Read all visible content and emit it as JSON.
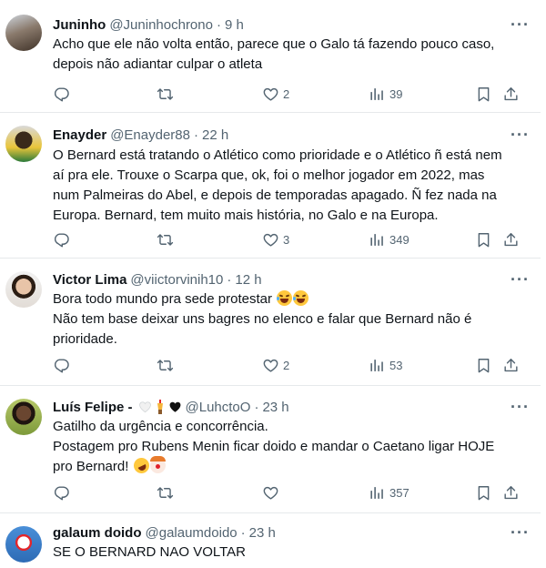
{
  "tweets": [
    {
      "name": "Juninho",
      "handle": "@Juninhochrono",
      "time": "9 h",
      "lines": [
        "Acho que ele não volta então, parece que o Galo tá fazendo pouco caso,",
        "depois não adiantar culpar o atleta"
      ],
      "likes": "2",
      "views": "39"
    },
    {
      "name": "Enayder",
      "handle": "@Enayder88",
      "time": "22 h",
      "lines": [
        "O Bernard está tratando o Atlético como prioridade e o Atlético ñ está nem",
        "aí pra ele. Trouxe o Scarpa que, ok, foi o melhor jogador em 2022, mas",
        "num Palmeiras do Abel, e depois de temporadas apagado. Ñ fez nada na",
        "Europa. Bernard, tem muito mais história, no Galo e na Europa."
      ],
      "likes": "3",
      "views": "349"
    },
    {
      "name": "Victor Lima",
      "handle": "@viictorvinih10",
      "time": "12 h",
      "lines": [
        "Bora todo mundo pra sede protestar",
        "Não tem base deixar uns bagres no elenco e falar que Bernard não é",
        "prioridade."
      ],
      "likes": "2",
      "views": "53"
    },
    {
      "name": "Luís Felipe -",
      "handle": "@LuhctoO",
      "time": "23 h",
      "lines": [
        "Gatilho da urgência e concorrência.",
        "Postagem pro Rubens Menin ficar doido e mandar o Caetano ligar HOJE",
        "pro Bernard!"
      ],
      "likes": "",
      "views": "357"
    },
    {
      "name": "galaum doido",
      "handle": "@galaumdoido",
      "time": "23 h",
      "lines": [
        "SE O BERNARD NAO VOLTAR"
      ]
    }
  ],
  "ui": {
    "separator": "·",
    "more": "···"
  },
  "icons": {
    "reply": "reply-icon",
    "retweet": "retweet-icon",
    "like": "heart-icon",
    "views": "views-chart-icon",
    "bookmark": "bookmark-icon",
    "share": "share-icon",
    "more": "more-icon"
  },
  "colors": {
    "secondary_text": "#536471",
    "primary_text": "#0f1419",
    "divider": "#e6e9eb"
  }
}
